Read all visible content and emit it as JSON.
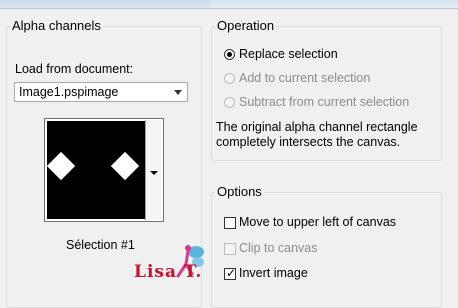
{
  "alpha_group": {
    "title": "Alpha channels",
    "load_label": "Load from document:",
    "document_value": "Image1.pspimage",
    "selection_label": "Sélection #1"
  },
  "operation_group": {
    "title": "Operation",
    "options": [
      {
        "label": "Replace selection",
        "selected": true,
        "enabled": true
      },
      {
        "label": "Add to current selection",
        "selected": false,
        "enabled": false
      },
      {
        "label": "Subtract from current selection",
        "selected": false,
        "enabled": false
      }
    ],
    "description": "The original alpha channel rectangle completely intersects the canvas."
  },
  "options_group": {
    "title": "Options",
    "items": [
      {
        "label": "Move to upper left of canvas",
        "checked": false,
        "enabled": true
      },
      {
        "label": "Clip to canvas",
        "checked": false,
        "enabled": false
      },
      {
        "label": "Invert image",
        "checked": true,
        "enabled": true
      }
    ]
  },
  "watermark": {
    "text": "Lisa T.",
    "color": "#c8102e"
  }
}
